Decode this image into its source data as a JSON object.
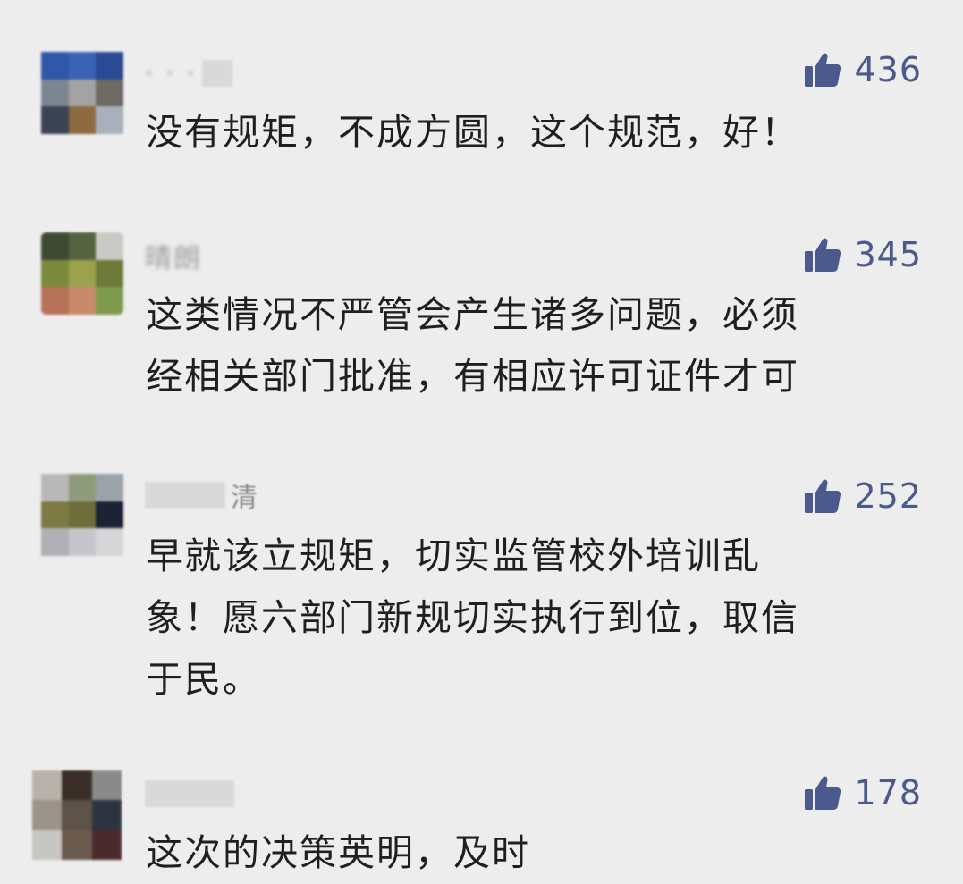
{
  "comments": [
    {
      "name": "·  ·  ·",
      "likes": "436",
      "text": "没有规矩，不成方圆，这个规范，好！",
      "avatar_colors": [
        "#2f57a8",
        "#3b63b4",
        "#2a4a95",
        "#7d8590",
        "#a3a3a3",
        "#6e6a64",
        "#3b4452",
        "#8c6b3f",
        "#a8b0bb"
      ]
    },
    {
      "name": "晴朗",
      "likes": "345",
      "text": "这类情况不严管会产生诸多问题，必须\n经相关部门批准，有相应许可证件才可",
      "avatar_colors": [
        "#3e4a32",
        "#55633e",
        "#c9c9c5",
        "#7b8a3c",
        "#9aa24d",
        "#6e7a3a",
        "#b8725a",
        "#c98a6c",
        "#7e9b4c"
      ]
    },
    {
      "name": "清",
      "likes": "252",
      "text": "早就该立规矩，切实监管校外培训乱\n象！愿六部门新规切实执行到位，取信\n于民。",
      "avatar_colors": [
        "#b8b8b8",
        "#8f9a7a",
        "#9ba2a8",
        "#7b7a42",
        "#6f6d3c",
        "#1c2233",
        "#aeb0b4",
        "#c4c6cc",
        "#d6d6d9"
      ]
    },
    {
      "name": "",
      "likes": "178",
      "text": "这次的决策英明，及时",
      "avatar_colors": [
        "#b9b2ab",
        "#3a2f28",
        "#8a8a88",
        "#9c9488",
        "#5d5148",
        "#2d3441",
        "#c8c6c3",
        "#6b5a4e",
        "#4b2a2d"
      ]
    }
  ],
  "colors": {
    "background": "#ededed",
    "like_icon": "#4a5a8c",
    "like_count": "#4a5a8c",
    "text": "#1f1f1f"
  },
  "icons": {
    "like": "thumbs-up-icon"
  }
}
